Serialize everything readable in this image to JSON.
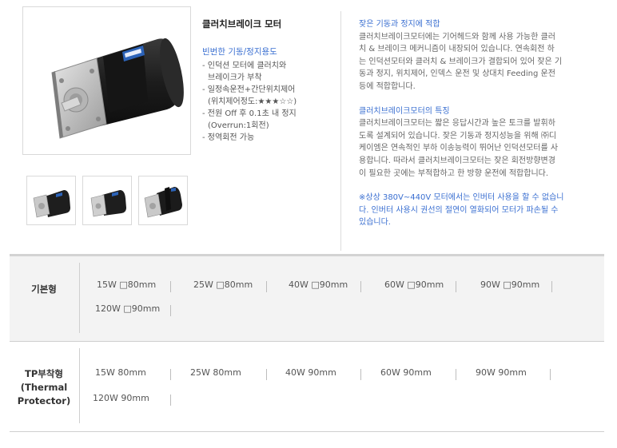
{
  "product": {
    "title": "클러치브레이크 모터",
    "use_title": "빈번한 기동/정지용도",
    "features": [
      "- 인덕션 모터에 클러치와",
      "  브레이크가 부착",
      "- 일정속운전+간단위치제어",
      "  (위치제어정도:★★★☆☆)",
      "- 전원 Off 후 0.1초 내 정지",
      "  (Overrun:1회전)",
      "- 정역회전 가능"
    ]
  },
  "description": {
    "section1_title": "잦은 기동과 정지에 적합",
    "section1_lines": [
      "클러치브레이크모터에는 기어헤드와 함께 사용 가능한 클러",
      "치 & 브레이크 메커니즘이 내장되어 있습니다. 연속회전 하",
      "는 인덕션모터와 클러치 & 브레이크가 결합되어 있어 잦은 기",
      "동과 정지, 위치제어, 인덱스 운전 및 상대치 Feeding 운전",
      "등에 적합합니다."
    ],
    "section2_title": "클러치브레이크모터의 특징",
    "section2_lines": [
      "클러치브레이크모터는 짧은 응답시간과 높은 토크를 발휘하",
      "도록 설계되어 있습니다. 잦은 기동과 정지성능을 위해 ㈜디",
      "케이엠은 연속적인 부하 이송능력이 뛰어난 인덕션모터를 사",
      "용합니다. 따라서 클러치브레이크모터는 잦은 회전방향변경",
      "이 필요한 곳에는 부적합하고 한 방향 운전에 적합합니다."
    ],
    "notice_lines": [
      "※상상 380V~440V 모터에서는 인버터 사용을 할 수 없습니",
      "다. 인버터 사용시 권선의 절연이 열화되어 모터가 파손될 수",
      "있습니다."
    ]
  },
  "spec_table": {
    "basic": {
      "label": "기본형",
      "items": [
        "15W □80mm",
        "25W □80mm",
        "40W □90mm",
        "60W □90mm",
        "90W □90mm",
        "120W □90mm"
      ]
    },
    "tp": {
      "label_lines": [
        "TP부착형",
        "(Thermal",
        "Protector)"
      ],
      "items": [
        "15W 80mm",
        "25W 80mm",
        "40W 90mm",
        "60W 90mm",
        "90W 90mm",
        "120W 90mm"
      ]
    }
  },
  "colors": {
    "accent": "#3a6fd1",
    "grey_row": "#f3f3f3",
    "motor_body": "#1f1f1f",
    "flange": "#c8c8c8",
    "label_blue": "#2c63b8"
  },
  "icons": {
    "main_photo": "clutch-brake-motor-photo",
    "thumbnails": [
      "motor-thumbnail-1",
      "motor-thumbnail-2",
      "motor-thumbnail-3"
    ]
  }
}
